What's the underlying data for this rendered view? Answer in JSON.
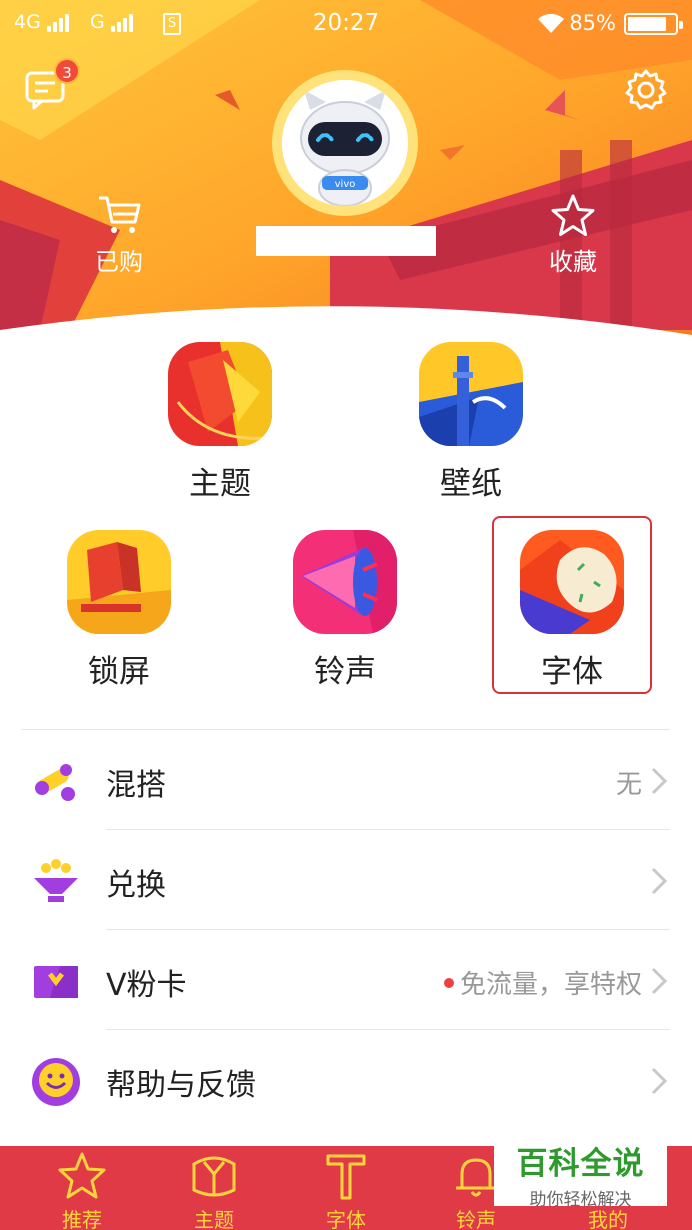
{
  "status_bar": {
    "network1": "4G",
    "network2": "G",
    "sim_icon": "S",
    "time": "20:27",
    "battery": "85%"
  },
  "header": {
    "message_badge": "3",
    "bought_label": "已购",
    "favorites_label": "收藏",
    "avatar_text": "vivo"
  },
  "categories": {
    "theme": "主题",
    "wallpaper": "壁纸",
    "lockscreen": "锁屏",
    "ringtone": "铃声",
    "font": "字体"
  },
  "list": [
    {
      "label": "混搭",
      "value": "无",
      "icon": "mix-icon"
    },
    {
      "label": "兑换",
      "value": "",
      "icon": "exchange-icon"
    },
    {
      "label": "V粉卡",
      "value": "免流量，享特权",
      "icon": "vcard-icon"
    },
    {
      "label": "帮助与反馈",
      "value": "",
      "icon": "help-icon"
    }
  ],
  "bottom_nav": {
    "recommend": "推荐",
    "theme": "主题",
    "font": "字体",
    "ringtone": "铃声",
    "mine": "我的"
  },
  "watermark": {
    "title": "百科全说",
    "subtitle": "助你轻松解决"
  },
  "colors": {
    "header_yellow": "#ffb32a",
    "header_orange": "#f57a1f",
    "header_red": "#d8303e",
    "nav_red": "#e13a47",
    "nav_text": "#ffd53d",
    "highlight_border": "#d8323a"
  }
}
